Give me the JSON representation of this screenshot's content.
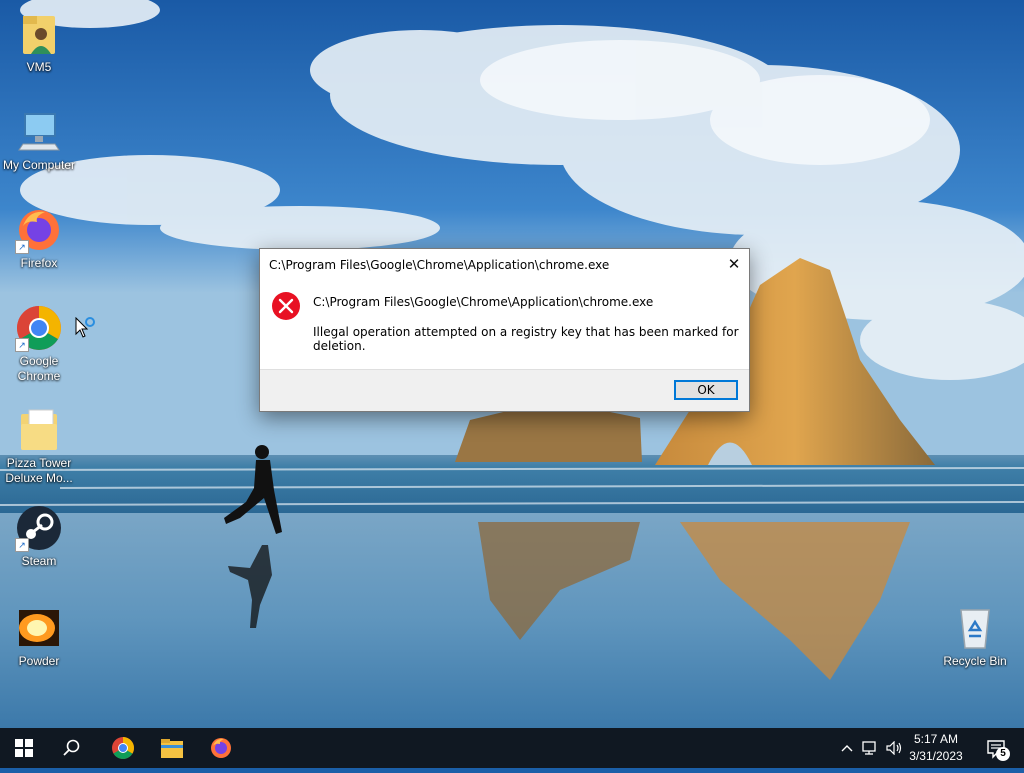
{
  "desktop": {
    "icons": [
      {
        "label": "VM5",
        "icon": "user-folder-icon"
      },
      {
        "label": "My Computer",
        "icon": "computer-icon"
      },
      {
        "label": "Firefox",
        "icon": "firefox-icon"
      },
      {
        "label": "Google Chrome",
        "icon": "chrome-icon"
      },
      {
        "label": "Pizza Tower Deluxe Mo...",
        "icon": "folder-icon"
      },
      {
        "label": "Steam",
        "icon": "steam-icon"
      },
      {
        "label": "Powder",
        "icon": "powder-icon"
      },
      {
        "label": "Recycle Bin",
        "icon": "recycle-bin-icon"
      }
    ]
  },
  "dialog": {
    "title": "C:\\Program Files\\Google\\Chrome\\Application\\chrome.exe",
    "close_label": "✕",
    "message_path": "C:\\Program Files\\Google\\Chrome\\Application\\chrome.exe",
    "message_text": "Illegal operation attempted on a registry key that has been marked for deletion.",
    "ok_label": "OK",
    "icon": "error-icon"
  },
  "taskbar": {
    "pinned": [
      "start-icon",
      "search-icon",
      "chrome-icon",
      "file-explorer-icon",
      "firefox-icon"
    ],
    "clock": {
      "time": "5:17 AM",
      "date": "3/31/2023"
    },
    "notifications": {
      "count": "5"
    },
    "accent_color": "#0078d7"
  }
}
